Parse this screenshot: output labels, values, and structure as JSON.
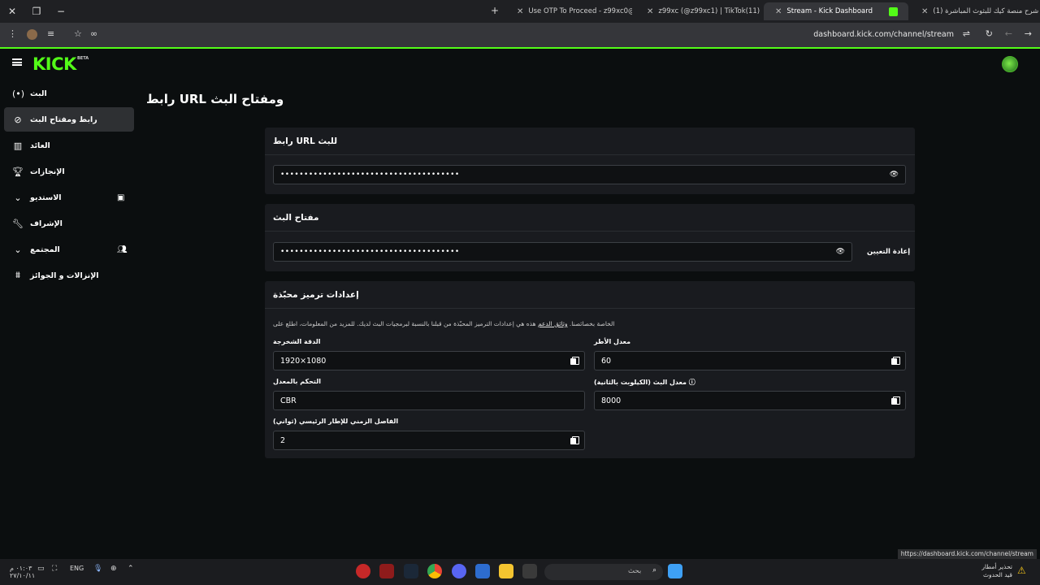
{
  "browser": {
    "tabs": [
      {
        "title": "(1) شرح منصة كيك للبثوث المباشرة",
        "active": false
      },
      {
        "title": "Stream - Kick Dashboard",
        "active": true
      },
      {
        "title": "z99xc (@z99xc1) | TikTok(11)",
        "active": false
      },
      {
        "title": "Use OTP To Proceed - z99xc0@",
        "active": false
      }
    ],
    "url": "dashboard.kick.com/channel/stream",
    "status_url": "https://dashboard.kick.com/channel/stream"
  },
  "app": {
    "logo": "KICK",
    "beta": "BETA",
    "page_title": "رابط URL ومفتاح البث"
  },
  "sidebar": {
    "items": [
      {
        "label": "البث",
        "icon": "broadcast-icon"
      },
      {
        "label": "رابط ومفتاح البث",
        "icon": "link-icon",
        "active": true
      },
      {
        "label": "العائد",
        "icon": "chart-icon"
      },
      {
        "label": "الإنجازات",
        "icon": "trophy-icon"
      },
      {
        "label": "الاستديو",
        "icon": "chevron-down-icon"
      },
      {
        "label": "الإشراف",
        "icon": "wrench-icon"
      },
      {
        "label": "المجتمع",
        "icon": "chevron-down-icon"
      },
      {
        "label": "الإنزالات و الجوائز",
        "icon": "gift-icon"
      }
    ]
  },
  "stream_url": {
    "heading": "رابط URL للبث",
    "value": "••••••••••••••••••••••••••••••••••••••"
  },
  "stream_key": {
    "heading": "مفتاح البث",
    "value": "••••••••••••••••••••••••••••••••••••••",
    "reset_label": "إعادة التعيين"
  },
  "encoder": {
    "heading": "إعدادات ترميز محبّذة",
    "description_pre": "هذه هي إعدادات الترميز المحبّذة من قبلنا بالنسبة لبرمجيات البث لديك. للمزيد من المعلومات، اطلع على",
    "description_link": "وثائق الدعم",
    "description_post": "الخاصة بخصائصنا.",
    "fields": {
      "resolution": {
        "label": "الدقة الشخرجة",
        "value": "1920×1080"
      },
      "fps": {
        "label": "معدل الأطر",
        "value": "60"
      },
      "rate_control": {
        "label": "التحكم بالمعدل",
        "value": "CBR"
      },
      "bitrate": {
        "label": "معدل البث (الكيلوبت بالثانية)",
        "value": "8000"
      },
      "keyframe": {
        "label": "الفاصل الزمني للإطار الرئيسي (ثواني)",
        "value": "2"
      }
    }
  },
  "taskbar": {
    "search_placeholder": "بحث",
    "lang": "ENG",
    "time": "٠١:٠٣ م",
    "date": "٢٧/١٠/١١",
    "weather": "تحذير أمطار",
    "weather_sub": "قيد الحدوث"
  }
}
